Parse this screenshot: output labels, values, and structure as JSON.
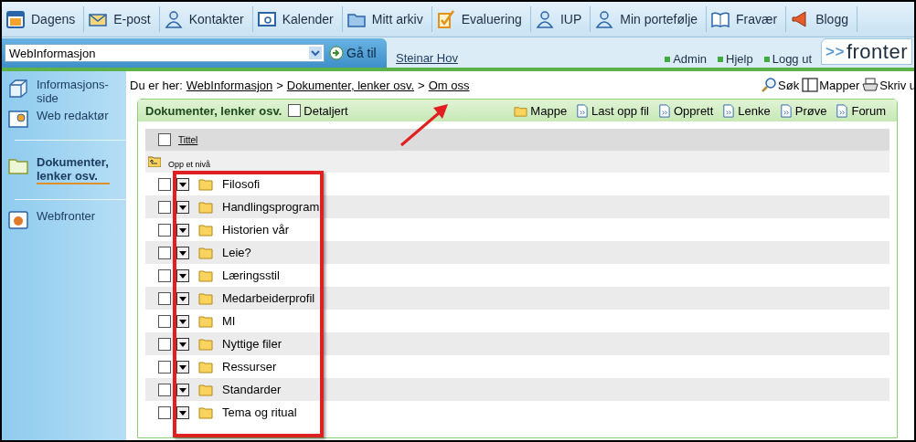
{
  "nav": [
    {
      "label": "Dagens"
    },
    {
      "label": "E-post"
    },
    {
      "label": "Kontakter"
    },
    {
      "label": "Kalender"
    },
    {
      "label": "Mitt arkiv"
    },
    {
      "label": "Evaluering"
    },
    {
      "label": "IUP"
    },
    {
      "label": "Min portefølje"
    },
    {
      "label": "Fravær"
    },
    {
      "label": "Blogg"
    }
  ],
  "room_select": {
    "value": "WebInformasjon"
  },
  "go_button": "Gå til",
  "user": "Steinar Hov",
  "top_links": [
    "Admin",
    "Hjelp",
    "Logg ut"
  ],
  "logo": {
    "arrows": ">>",
    "word": "fronter"
  },
  "sidebar": {
    "items": [
      {
        "label": "Informasjons-side",
        "selected": false
      },
      {
        "label": "Web redaktør",
        "selected": false
      },
      {
        "label": "Dokumenter, lenker osv.",
        "selected": true
      },
      {
        "label": "Webfronter",
        "selected": false
      }
    ]
  },
  "breadcrumb": {
    "prefix": "Du er her:",
    "items": [
      "WebInformasjon",
      "Dokumenter, lenker osv.",
      "Om oss"
    ],
    "separator": ">"
  },
  "tools": [
    "Søk",
    "Mapper",
    "Skriv u"
  ],
  "panel": {
    "title": "Dokumenter, lenker osv.",
    "detail": {
      "label": "Detaljert",
      "checked": false
    },
    "actions": [
      "Mappe",
      "Last opp fil",
      "Opprett",
      "Lenke",
      "Prøve",
      "Forum"
    ],
    "column": "Tittel",
    "select_all": {
      "checked": false
    },
    "up_level": "Opp et nivå",
    "rows": [
      {
        "name": "Filosofi",
        "checked": false
      },
      {
        "name": "Handlingsprogram",
        "checked": false
      },
      {
        "name": "Historien vår",
        "checked": false
      },
      {
        "name": "Leie?",
        "checked": false
      },
      {
        "name": "Læringsstil",
        "checked": false
      },
      {
        "name": "Medarbeiderprofil",
        "checked": false
      },
      {
        "name": "MI",
        "checked": false
      },
      {
        "name": "Nyttige filer",
        "checked": false
      },
      {
        "name": "Ressurser",
        "checked": false
      },
      {
        "name": "Standarder",
        "checked": false
      },
      {
        "name": "Tema og ritual",
        "checked": false
      }
    ]
  }
}
